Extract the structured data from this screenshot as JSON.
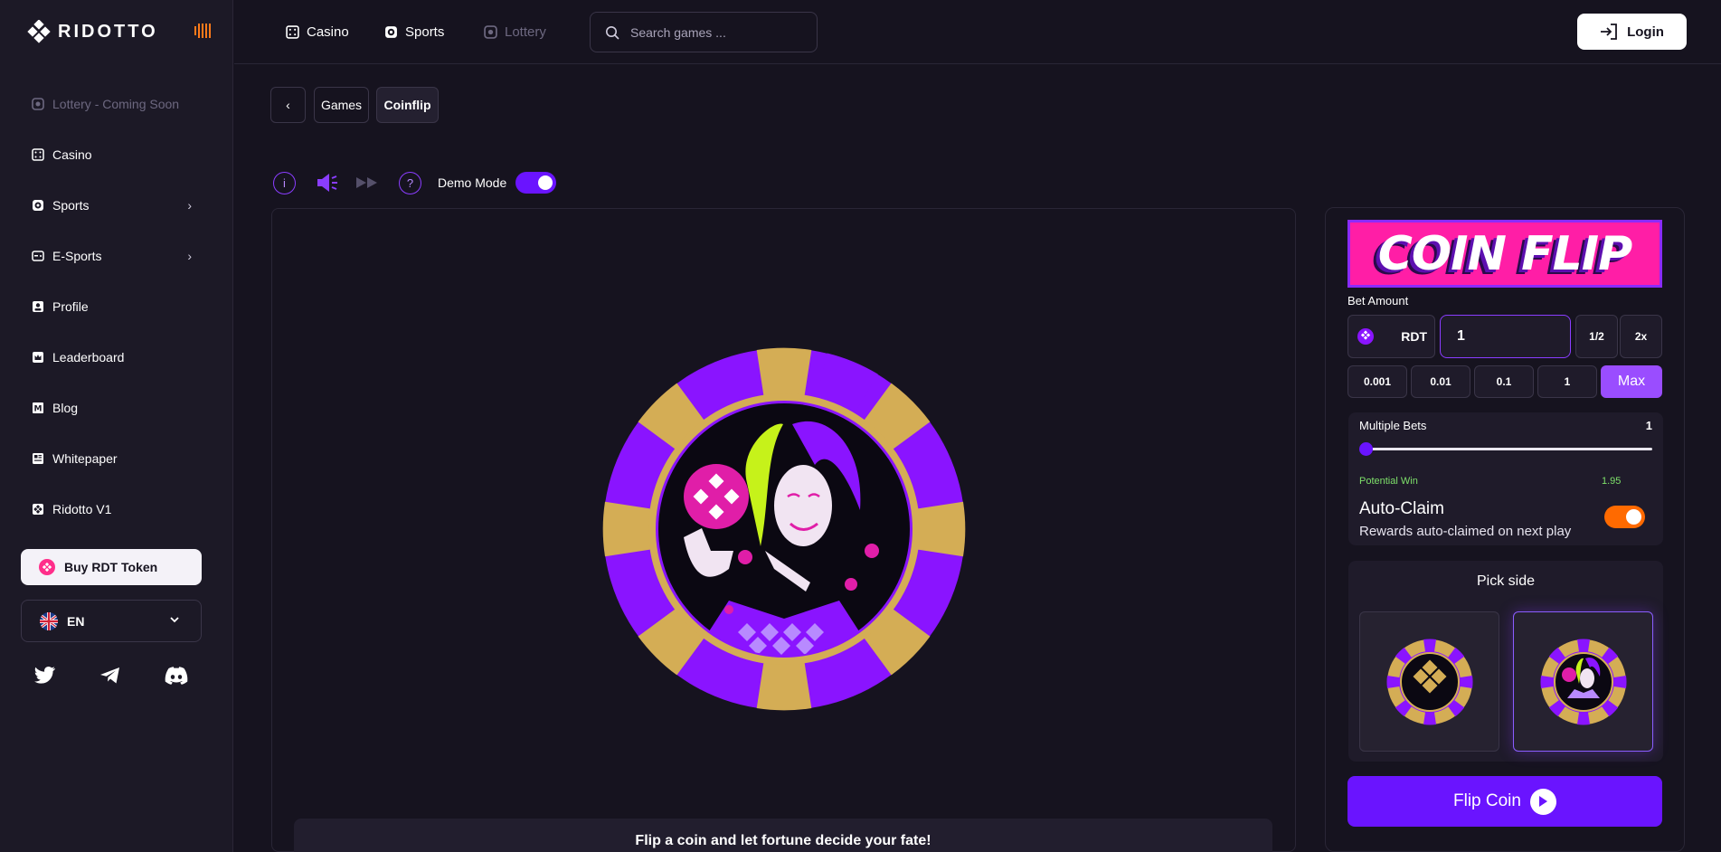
{
  "app": {
    "name": "RIDOTTO"
  },
  "sidebar": {
    "items": [
      {
        "label": "Lottery - Coming Soon",
        "icon": "lottery-icon",
        "disabled": true
      },
      {
        "label": "Casino",
        "icon": "dice-icon"
      },
      {
        "label": "Sports",
        "icon": "sports-icon",
        "has_submenu": true
      },
      {
        "label": "E-Sports",
        "icon": "gamepad-icon",
        "has_submenu": true
      },
      {
        "label": "Profile",
        "icon": "profile-icon"
      },
      {
        "label": "Leaderboard",
        "icon": "crown-icon"
      },
      {
        "label": "Blog",
        "icon": "medium-icon"
      },
      {
        "label": "Whitepaper",
        "icon": "document-icon"
      },
      {
        "label": "Ridotto V1",
        "icon": "ridotto-icon"
      }
    ],
    "buy_button": "Buy RDT Token",
    "language": "EN"
  },
  "topbar": {
    "tabs": [
      {
        "label": "Casino",
        "icon": "dice-icon"
      },
      {
        "label": "Sports",
        "icon": "sports-icon"
      },
      {
        "label": "Lottery",
        "icon": "lottery-icon",
        "disabled": true
      }
    ],
    "search_placeholder": "Search games ...",
    "login_label": "Login"
  },
  "breadcrumb": {
    "back": "‹",
    "items": [
      "Games",
      "Coinflip"
    ]
  },
  "controls": {
    "demo_mode_label": "Demo Mode",
    "demo_mode_on": true
  },
  "game": {
    "description": "Flip a coin and let fortune decide your fate!"
  },
  "bet_panel": {
    "banner_text": "COIN FLIP",
    "bet_amount_label": "Bet Amount",
    "currency": "RDT",
    "bet_value": "1",
    "half_label": "1/2",
    "double_label": "2x",
    "quick_amounts": [
      "0.001",
      "0.01",
      "0.1",
      "1"
    ],
    "max_label": "Max",
    "multiple_bets_label": "Multiple Bets",
    "multiple_bets_value": "1",
    "multiple_bets_fraction": 0,
    "potential_win_label": "Potential Win",
    "potential_win_value": "1.95",
    "auto_claim_title": "Auto-Claim",
    "auto_claim_subtitle": "Rewards auto-claimed on next play",
    "auto_claim_on": true,
    "pick_side_label": "Pick side",
    "selected_side": 1,
    "flip_button": "Flip Coin"
  },
  "colors": {
    "accent": "#6a14ff",
    "pink": "#ff1ea6",
    "gold": "#d4ad55",
    "purple": "#8a14ff",
    "orange": "#ff6a00",
    "green": "#7ee06a"
  }
}
